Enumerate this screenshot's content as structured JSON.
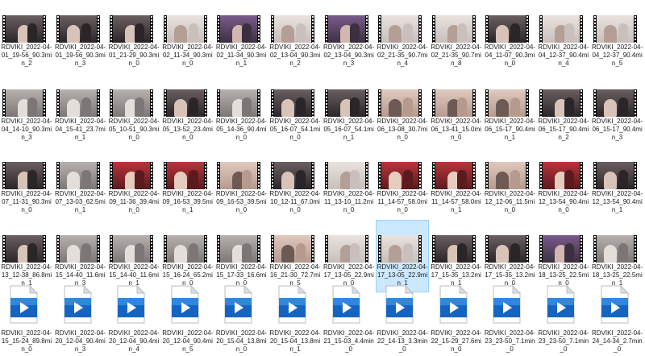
{
  "rows": [
    {
      "kind": "video",
      "items": [
        {
          "name": "RDVIKI_2022-04-01_19-56_90.3min_2",
          "scene": "dark"
        },
        {
          "name": "RDVIKI_2022-04-01_19-56_90.3min_3",
          "scene": "dark"
        },
        {
          "name": "RDVIKI_2022-04-01_21-29_90.3min_0",
          "scene": "dark"
        },
        {
          "name": "RDVIKI_2022-04-02_11-34_90.3min_0",
          "scene": "light"
        },
        {
          "name": "RDVIKI_2022-04-02_11-34_90.3min_1",
          "scene": "purple"
        },
        {
          "name": "RDVIKI_2022-04-02_13-04_90.3min_2",
          "scene": "light"
        },
        {
          "name": "RDVIKI_2022-04-02_13-04_90.3min_3",
          "scene": "purple"
        },
        {
          "name": "RDVIKI_2022-04-02_21-35_90.7min_4",
          "scene": "light"
        },
        {
          "name": "RDVIKI_2022-04-02_21-35_90.7min_8",
          "scene": "light"
        },
        {
          "name": "RDVIKI_2022-04-04_11-07_90.3min_0",
          "scene": "dark"
        },
        {
          "name": "RDVIKI_2022-04-04_12-37_90.4min_4",
          "scene": "light"
        },
        {
          "name": "RDVIKI_2022-04-04_12-37_90.4min_5",
          "scene": "light"
        }
      ]
    },
    {
      "kind": "video",
      "items": [
        {
          "name": "RDVIKI_2022-04-04_14-10_90.3min_3",
          "scene": "gray"
        },
        {
          "name": "RDVIKI_2022-04-04_15-41_23.7min_1",
          "scene": "gray"
        },
        {
          "name": "RDVIKI_2022-04-05_10-51_90.3min_0",
          "scene": "gray"
        },
        {
          "name": "RDVIKI_2022-04-05_13-52_23.4min_0",
          "scene": "dark"
        },
        {
          "name": "RDVIKI_2022-04-05_14-36_90.4min_0",
          "scene": "gray"
        },
        {
          "name": "RDVIKI_2022-04-05_16-07_54.1min_0",
          "scene": "dark"
        },
        {
          "name": "RDVIKI_2022-04-05_16-07_54.1min_1",
          "scene": "dark"
        },
        {
          "name": "RDVIKI_2022-04-06_13-08_30.7min_0",
          "scene": "skin"
        },
        {
          "name": "RDVIKI_2022-04-06_13-41_15.0min_0",
          "scene": "skin"
        },
        {
          "name": "RDVIKI_2022-04-06_15-17_90.4min_1",
          "scene": "skin"
        },
        {
          "name": "RDVIKI_2022-04-06_15-17_90.4min_2",
          "scene": "dark"
        },
        {
          "name": "RDVIKI_2022-04-06_15-17_90.4min_3",
          "scene": "dark"
        }
      ]
    },
    {
      "kind": "video",
      "items": [
        {
          "name": "RDVIKI_2022-04-07_11-31_90.3min_0",
          "scene": "dark"
        },
        {
          "name": "RDVIKI_2022-04-07_13-03_62.5min_1",
          "scene": "gray"
        },
        {
          "name": "RDVIKI_2022-04-09_11-36_39.4min_0",
          "scene": "red"
        },
        {
          "name": "RDVIKI_2022-04-09_16-53_39.5min_1",
          "scene": "red"
        },
        {
          "name": "RDVIKI_2022-04-09_16-53_39.5min_0",
          "scene": "skin"
        },
        {
          "name": "RDVIKI_2022-04-10_12-11_67.0min_0",
          "scene": "dark"
        },
        {
          "name": "RDVIKI_2022-04-11_13-10_11.2min_0",
          "scene": "light"
        },
        {
          "name": "RDVIKI_2022-04-11_14-57_58.0min_0",
          "scene": "red"
        },
        {
          "name": "RDVIKI_2022-04-11_14-57_58.0min_1",
          "scene": "red"
        },
        {
          "name": "RDVIKI_2022-04-12_12-06_11.5min_0",
          "scene": "skin"
        },
        {
          "name": "RDVIKI_2022-04-12_13-54_90.4min_0",
          "scene": "red"
        },
        {
          "name": "RDVIKI_2022-04-12_13-54_90.4min_1",
          "scene": "dark"
        }
      ]
    },
    {
      "kind": "video",
      "items": [
        {
          "name": "RDVIKI_2022-04-13_12-38_86.8min_1",
          "scene": "dark"
        },
        {
          "name": "RDVIKI_2022-04-15_14-40_11.6min_3",
          "scene": "gray"
        },
        {
          "name": "RDVIKI_2022-04-15_14-40_11.6min_1",
          "scene": "gray"
        },
        {
          "name": "RDVIKI_2022-04-15_16-24_65.2min_0",
          "scene": "gray"
        },
        {
          "name": "RDVIKI_2022-04-15_17-33_16.6min_0",
          "scene": "gray"
        },
        {
          "name": "RDVIKI_2022-04-16_21-30_72.7min_5",
          "scene": "skin"
        },
        {
          "name": "RDVIKI_2022-04-17_13-05_22.9min_0",
          "scene": "light"
        },
        {
          "name": "RDVIKI_2022-04-17_13-05_22.9min_1",
          "scene": "light",
          "selected": true
        },
        {
          "name": "RDVIKI_2022-04-17_15-35_13.2min_1",
          "scene": "dark"
        },
        {
          "name": "RDVIKI_2022-04-17_15-35_13.2min_0",
          "scene": "dark"
        },
        {
          "name": "RDVIKI_2022-04-18_13-25_22.5min_0",
          "scene": "purple"
        },
        {
          "name": "RDVIKI_2022-04-18_13-25_22.5min_1",
          "scene": "gray"
        }
      ]
    },
    {
      "kind": "file",
      "items": [
        {
          "name": "RDVIKI_2022-04-15_15-24_89.8min_0"
        },
        {
          "name": "RDVIKI_2022-04-20_12-04_90.4min_3"
        },
        {
          "name": "RDVIKI_2022-04-20_12-04_90.4min_4"
        },
        {
          "name": "RDVIKI_2022-04-20_12-04_90.4min_5"
        },
        {
          "name": "RDVIKI_2022-04-20_15-04_13.8min_0"
        },
        {
          "name": "RDVIKI_2022-04-20_15-04_13.8min_1"
        },
        {
          "name": "RDVIKI_2022-04-21_15-03_4.4min_0"
        },
        {
          "name": "RDVIKI_2022-04-22_14-13_3.3min_0"
        },
        {
          "name": "RDVIKI_2022-04-22_15-29_27.6min_0"
        },
        {
          "name": "RDVIKI_2022-04-23_23-50_7.1min_0"
        },
        {
          "name": "RDVIKI_2022-04-23_23-50_7.1min_0"
        },
        {
          "name": "RDVIKI_2022-04-24_14-34_2.7min_0"
        }
      ]
    }
  ],
  "scene_colors": {
    "dark": [
      "#2a2528",
      "#6b5f61",
      "#d8c3b8"
    ],
    "light": [
      "#c9c0bd",
      "#e8e2df",
      "#b49f97"
    ],
    "purple": [
      "#3b3040",
      "#7b5a8c",
      "#d2b7b0"
    ],
    "gray": [
      "#7c7776",
      "#b7b1ae",
      "#e4dedb"
    ],
    "skin": [
      "#b79a8e",
      "#e0c9bf",
      "#6e5a55"
    ],
    "red": [
      "#5a1a1e",
      "#b8343b",
      "#e6cbbf"
    ]
  },
  "file_icon_colors": {
    "page": "#ffffff",
    "fold": "#d9dde2",
    "band": "#1565c0",
    "band_light": "#42a5f5",
    "play": "#ffffff"
  }
}
